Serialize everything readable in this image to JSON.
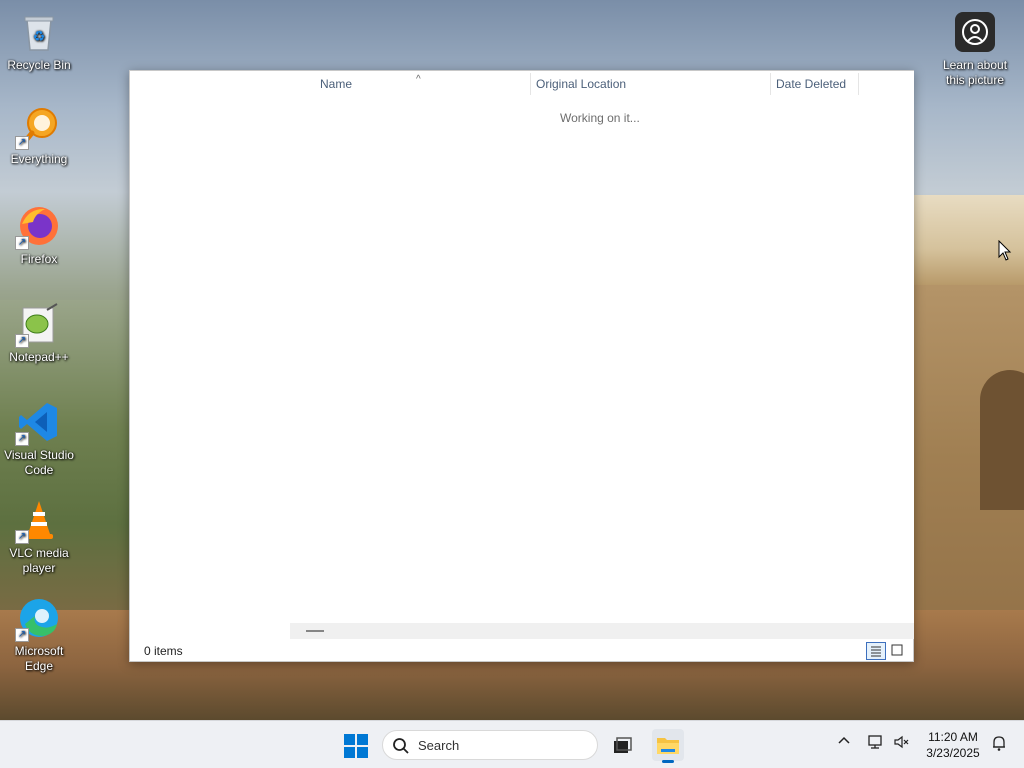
{
  "desktop": {
    "icons": [
      {
        "label": "Recycle Bin",
        "icon": "recycle-bin-icon"
      },
      {
        "label": "Everything",
        "icon": "everything-search-icon"
      },
      {
        "label": "Firefox",
        "icon": "firefox-icon"
      },
      {
        "label": "Notepad++",
        "icon": "notepad-plus-plus-icon"
      },
      {
        "label": "Visual Studio Code",
        "icon": "vscode-icon"
      },
      {
        "label": "VLC media player",
        "icon": "vlc-icon"
      },
      {
        "label": "Microsoft Edge",
        "icon": "edge-icon"
      }
    ],
    "learn_label": "Learn about this picture"
  },
  "explorer": {
    "columns": [
      {
        "label": "Name"
      },
      {
        "label": "Original Location"
      },
      {
        "label": "Date Deleted"
      }
    ],
    "sort_column": "Name",
    "status_message": "Working on it...",
    "item_count": "0 items",
    "view_mode": "details"
  },
  "taskbar": {
    "search_label": "Search",
    "time": "11:20 AM",
    "date": "3/23/2025",
    "active_app": "file-explorer"
  },
  "colors": {
    "accent": "#0067c0",
    "header_text": "#4c607a",
    "window_bg": "#ffffff",
    "taskbar_bg": "#eef0f4"
  }
}
